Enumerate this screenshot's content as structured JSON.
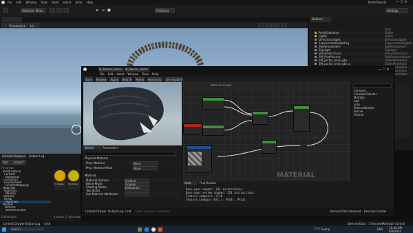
{
  "menubar": {
    "items": [
      "File",
      "Edit",
      "Window",
      "Tools",
      "Build",
      "Select",
      "Actor",
      "Help"
    ],
    "project": "PortalTutorial"
  },
  "toolbar": {
    "mode_label": "Selection Mode",
    "platforms_label": "Platforms",
    "settings_label": "Settings"
  },
  "viewport": {
    "view_mode": "Perspective",
    "lit_label": "Lit"
  },
  "outliner": {
    "tab_label": "Outliner",
    "type_header": "Type",
    "rows": [
      {
        "label": "PortalGateway",
        "type": "Folder"
      },
      {
        "label": "Lights",
        "type": "Folder"
      },
      {
        "label": "DirectionalLight",
        "type": "DirectionalLight"
      },
      {
        "label": "ExponentialHeightFog",
        "type": "ExponentialHeightFog"
      },
      {
        "label": "SkyAtmosphere",
        "type": "SkyAtmosphere"
      },
      {
        "label": "SkyLight",
        "type": "SkyLight"
      },
      {
        "label": "VolumetricCloud",
        "type": "VolumetricCloud"
      },
      {
        "label": "SM_PostProcess",
        "type": "PostProcessVolume"
      },
      {
        "label": "SM_portal_cross_gbs",
        "type": "StaticMeshActor"
      },
      {
        "label": "SM_portal_cross_gbs_g",
        "type": "StaticMeshActor"
      },
      {
        "label": "SM_portal_rocks_g",
        "type": "StaticMeshActor"
      },
      {
        "label": "SM_portal_lighting_g",
        "type": "StaticMeshActor"
      },
      {
        "label": "SM_portal_lighting_2",
        "type": "StaticMeshActor"
      }
    ]
  },
  "content_browser": {
    "tab_label": "Content Browser",
    "tab2_label": "Output Log",
    "add_label": "Add",
    "import_label": "Import",
    "tree_header": "Favorites",
    "tree": [
      "PortalTutorial",
      "Content",
      "Blueprints",
      "Characters",
      "Environment",
      "LevelPrototyping",
      "Materials",
      "Materials",
      "Meshes",
      "Textures",
      "Portal",
      "Materials",
      "Meshes",
      "Textures",
      "StarterContent"
    ],
    "collections_label": "Collections",
    "status": "4 items (1 selected)",
    "assets": [
      {
        "name": "M_Master_Portal",
        "color": "#d9a400"
      },
      {
        "name": "MI_Portal",
        "color": "#c8b000"
      }
    ]
  },
  "material_editor": {
    "tab1": "M_Master_Portal",
    "tab2": "M_Master_Portal",
    "menu": [
      "File",
      "Edit",
      "Asset",
      "Window",
      "Tools",
      "Help"
    ],
    "toolbar": [
      "Save",
      "Browse",
      "Apply",
      "Search",
      "Home",
      "Hierarchy",
      "Live Update"
    ],
    "graph_breadcrumb": "Material Graph",
    "watermark": "MATERIAL",
    "details": {
      "tab_label": "Details",
      "tab2_label": "Parameters",
      "section_physical": "Physical Material",
      "section_material": "Material",
      "props": [
        {
          "label": "Phys Material",
          "value": "None"
        },
        {
          "label": "Phys Material Mask",
          "value": "None"
        },
        {
          "label": "Material Domain",
          "value": "Surface"
        },
        {
          "label": "Blend Mode",
          "value": "Opaque"
        },
        {
          "label": "Shading Model",
          "value": "Default Lit"
        },
        {
          "label": "Two Sided",
          "value": ""
        },
        {
          "label": "Use Material Attributes",
          "value": ""
        }
      ]
    },
    "stats": {
      "tab_label": "Stats",
      "tab2_label": "Find Results",
      "lines": [
        "Base pass shader: 142 instructions",
        "Base pass vertex shader: 153 instructions",
        "Texture samplers: 2/16",
        "Texture Lookups (Est.): VS(0), PS(2)"
      ]
    },
    "palette": {
      "items": [
        "Constant",
        "Constant3Vector",
        "Multiply",
        "Add",
        "Lerp",
        "TextureSample",
        "Panner",
        "Fresnel"
      ]
    },
    "bottom_bar": {
      "content_drawer": "Content Drawer",
      "output_log": "Output Log",
      "cmd": "Cmd",
      "command_placeholder": "Enter Console Command",
      "derived_data": "Derived Data",
      "unsaved": "Unsaved",
      "revision": "Revision Control"
    }
  },
  "status_bar": {
    "content_drawer": "Content Drawer",
    "output_log": "Output Log",
    "cmd": "Cmd",
    "derived_data": "Derived Data",
    "unsaved": "1 Unsaved",
    "revision": "Revision Control"
  },
  "taskbar": {
    "search_placeholder": "Search",
    "weather": "77°F Sunny",
    "lang": "ENG",
    "time": "11:44 AM",
    "date": "6/9/2024"
  }
}
